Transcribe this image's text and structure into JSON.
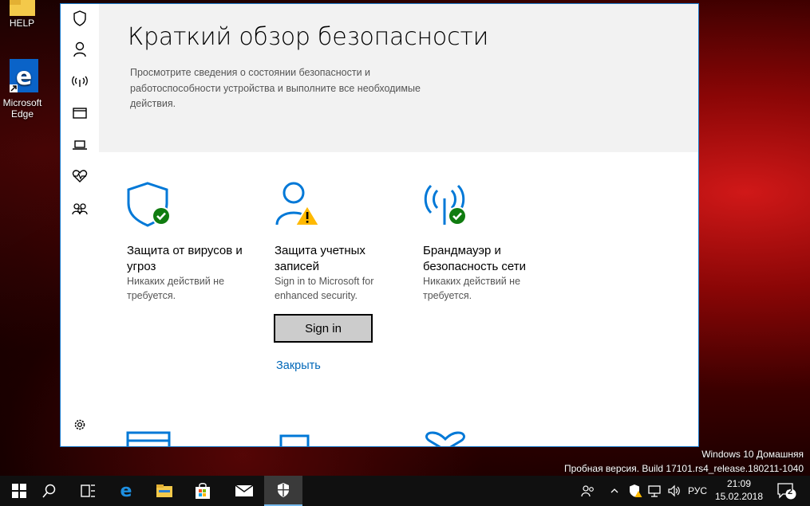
{
  "desktop": {
    "icons": [
      {
        "label": "HELP",
        "icon": "folder-icon"
      },
      {
        "label": "Microsoft Edge",
        "icon": "edge-icon"
      }
    ],
    "watermark_line1": "Windows 10 Домашняя",
    "watermark_line2": "Пробная версия. Build 17101.rs4_release.180211-1040"
  },
  "window": {
    "nav": [
      "shield-icon",
      "person-icon",
      "wireless-icon",
      "app-browser-icon",
      "laptop-icon",
      "heart-icon",
      "family-icon",
      "settings-gear-icon"
    ],
    "header": {
      "title": "Краткий обзор безопасности",
      "description": "Просмотрите сведения о состоянии безопасности и работоспособности устройства и выполните все необходимые действия."
    },
    "cards": [
      {
        "title": "Защита от вирусов и угроз",
        "status": "Никаких действий не требуется.",
        "icon": "virus-protection-shield-icon",
        "state": "ok"
      },
      {
        "title": "Защита учетных записей",
        "status": "Sign in to Microsoft for enhanced security.",
        "icon": "account-protection-icon",
        "state": "warning"
      },
      {
        "title": "Брандмауэр и безопасность сети",
        "status": "Никаких действий не требуется.",
        "icon": "firewall-network-icon",
        "state": "ok"
      }
    ],
    "signin_label": "Sign in",
    "close_label": "Закрыть"
  },
  "taskbar": {
    "items": [
      "windows-start-icon",
      "search-icon",
      "task-view-icon",
      "edge-icon",
      "file-explorer-icon",
      "store-icon",
      "mail-icon",
      "windows-security-icon"
    ],
    "language": "РУС",
    "time": "21:09",
    "date": "15.02.2018",
    "notifications_count": "2"
  },
  "colors": {
    "accent": "#0078d7",
    "ok": "#107c10",
    "warning": "#ffb900",
    "link": "#0067b8"
  }
}
